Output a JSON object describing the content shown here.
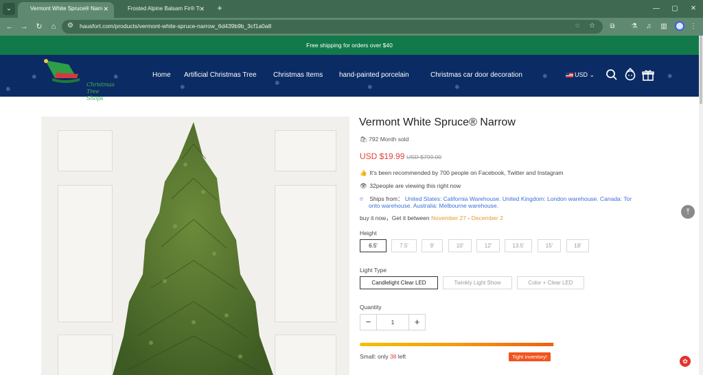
{
  "browser": {
    "tabs": [
      {
        "title": "Vermont White Spruce® Narrow",
        "active": true
      },
      {
        "title": "Frosted Alpine Balsam Fir® Tre",
        "active": false
      }
    ],
    "url": "hausfort.com/products/vermont-white-spruce-narrow_6d439b9b_3cf1a0a8",
    "tab_close_glyph": "✕",
    "new_tab_glyph": "+",
    "window_buttons": [
      "—",
      "▢",
      "✕"
    ]
  },
  "promo": {
    "text": "Free shipping for orders over $40"
  },
  "header": {
    "logo_text": "Christmas Tree Shops",
    "nav": [
      "Home",
      "Artificial Christmas Tree",
      "Christmas Items",
      "hand-painted porcelain",
      "Christmas car door decoration"
    ],
    "currency": "USD",
    "colors": {
      "promo_bg": "#127a4a",
      "header_bg": "#0b2b64"
    }
  },
  "product": {
    "title": "Vermont White Spruce® Narrow",
    "sold": "792 Month sold",
    "price": "USD $19.99",
    "compare_price": "USD $799.00",
    "recommended": "It's been recommended by 700 people on Facebook, Twitter and Instagram",
    "viewing": "32people are viewing this right now",
    "ships_label": "Ships from：",
    "ships_line1": "United States: California Warehouse. United Kingdom: London warehouse. Canada: Tor",
    "ships_line2": "onto warehouse. Australia: Melbourne warehouse.",
    "delivery_prefix": "buy it now，Get it between",
    "delivery_start": "November 27",
    "delivery_sep": "-",
    "delivery_end": "December 2",
    "height_label": "Height",
    "heights": [
      "6.5'",
      "7.5'",
      "9'",
      "10'",
      "12'",
      "13.5'",
      "15'",
      "18'"
    ],
    "selected_height": "6.5'",
    "light_label": "Light Type",
    "lights": [
      "Candlelight Clear LED",
      "Twinkly Light Show",
      "Color + Clear LED"
    ],
    "selected_light": "Candlelight Clear LED",
    "quantity_label": "Quantity",
    "quantity": "1",
    "qty_minus": "−",
    "qty_plus": "+",
    "stock_prefix": "Small: only",
    "stock_count": "38",
    "stock_suffix": "left",
    "stock_fill_fraction": 0.99,
    "stock_badge": "Tight inventory!",
    "colors": {
      "price": "#e0423a",
      "link": "#3a6fd8",
      "date": "#e59a2b",
      "badge": "#f0541e"
    }
  },
  "icons": {
    "sold": "bag-icon",
    "recommended": "thumbs-up-icon",
    "viewing": "eye-icon",
    "ships": "location-pin-icon",
    "back_to_top": "arrow-up-icon",
    "chat": "chat-icon"
  }
}
